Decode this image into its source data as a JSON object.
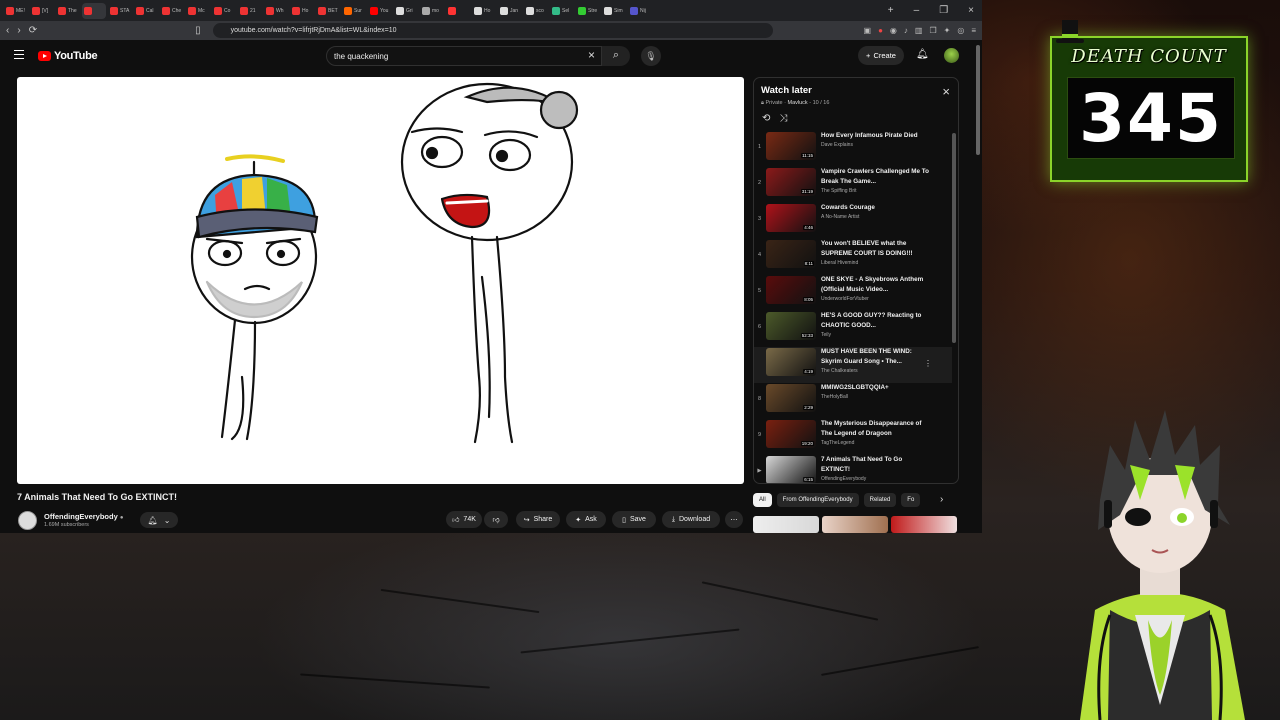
{
  "browser": {
    "tabs": [
      {
        "label": "ME!"
      },
      {
        "label": "[V]"
      },
      {
        "label": "The"
      },
      {
        "label": ""
      },
      {
        "label": "STA"
      },
      {
        "label": "Cal"
      },
      {
        "label": "Che"
      },
      {
        "label": "Mc"
      },
      {
        "label": "Co"
      },
      {
        "label": "21"
      },
      {
        "label": "Wh"
      },
      {
        "label": "Ho"
      },
      {
        "label": "BET"
      },
      {
        "label": "Sur"
      },
      {
        "label": "You"
      },
      {
        "label": "Gri"
      },
      {
        "label": "mo"
      },
      {
        "label": ""
      },
      {
        "label": "Ho"
      },
      {
        "label": "Jan"
      },
      {
        "label": "sco"
      },
      {
        "label": "Sel"
      },
      {
        "label": "Stre"
      },
      {
        "label": "Sim"
      },
      {
        "label": "Nij"
      }
    ],
    "url": "youtube.com/watch?v=lifrjtRjDmA&list=WL&index=10"
  },
  "youtube": {
    "logo": "YouTube",
    "search_value": "the quackening",
    "create_label": "Create"
  },
  "video": {
    "title": "7 Animals That Need To Go EXTINCT!",
    "channel": "OffendingEverybody",
    "subscribers": "1.69M subscribers",
    "likes": "74K",
    "share": "Share",
    "ask": "Ask",
    "save": "Save",
    "download": "Download"
  },
  "playlist": {
    "title": "Watch later",
    "privacy": "Private",
    "owner": "Mavluck",
    "position": "10 / 16",
    "items": [
      {
        "num": "1",
        "title": "How Every Infamous Pirate Died",
        "channel": "Dave Explains",
        "duration": "11:15",
        "color": "#7a2a14"
      },
      {
        "num": "2",
        "title": "Vampire Crawlers Challenged Me To Break The Game...",
        "channel": "The Spiffing Brit",
        "duration": "31:19",
        "color": "#8c1a1a"
      },
      {
        "num": "3",
        "title": "Cowards Courage",
        "channel": "A No-Name Artist",
        "duration": "4:46",
        "color": "#b0121a"
      },
      {
        "num": "4",
        "title": "You won't BELIEVE what the SUPREME COURT IS DOING!!!",
        "channel": "Liberal Hivemind",
        "duration": "8:11",
        "color": "#3a2416"
      },
      {
        "num": "5",
        "title": "ONE SKYE - A Skyebrows Anthem (Official Music Video...",
        "channel": "UnderworldForVtuber",
        "duration": "8:05",
        "color": "#5a0c0c"
      },
      {
        "num": "6",
        "title": "HE'S A GOOD GUY?? Reacting to CHAOTIC GOOD...",
        "channel": "Teily",
        "duration": "52:33",
        "color": "#4c5a2a"
      },
      {
        "num": "",
        "title": "MUST HAVE BEEN THE WIND: Skyrim Guard Song • The...",
        "channel": "The Chalkeaters",
        "duration": "4:19",
        "color": "#7a6a48"
      },
      {
        "num": "8",
        "title": "MMIWG2SLGBTQQIA+",
        "channel": "TheHolyBall",
        "duration": "2:29",
        "color": "#6a4a2a"
      },
      {
        "num": "9",
        "title": "The Mysterious Disappearance of The Legend of Dragoon",
        "channel": "TagTheLegend",
        "duration": "19:20",
        "color": "#7a2010"
      },
      {
        "num": "▶",
        "title": "7 Animals That Need To Go EXTINCT!",
        "channel": "OffendingEverybody",
        "duration": "6:15",
        "color": "#d8d8d8"
      }
    ]
  },
  "chips": [
    "All",
    "From OffendingEverybody",
    "Related",
    "Fo"
  ],
  "overlay": {
    "death_count_label": "DEATH COUNT",
    "death_count": "345",
    "accent": "#8bd42a"
  }
}
